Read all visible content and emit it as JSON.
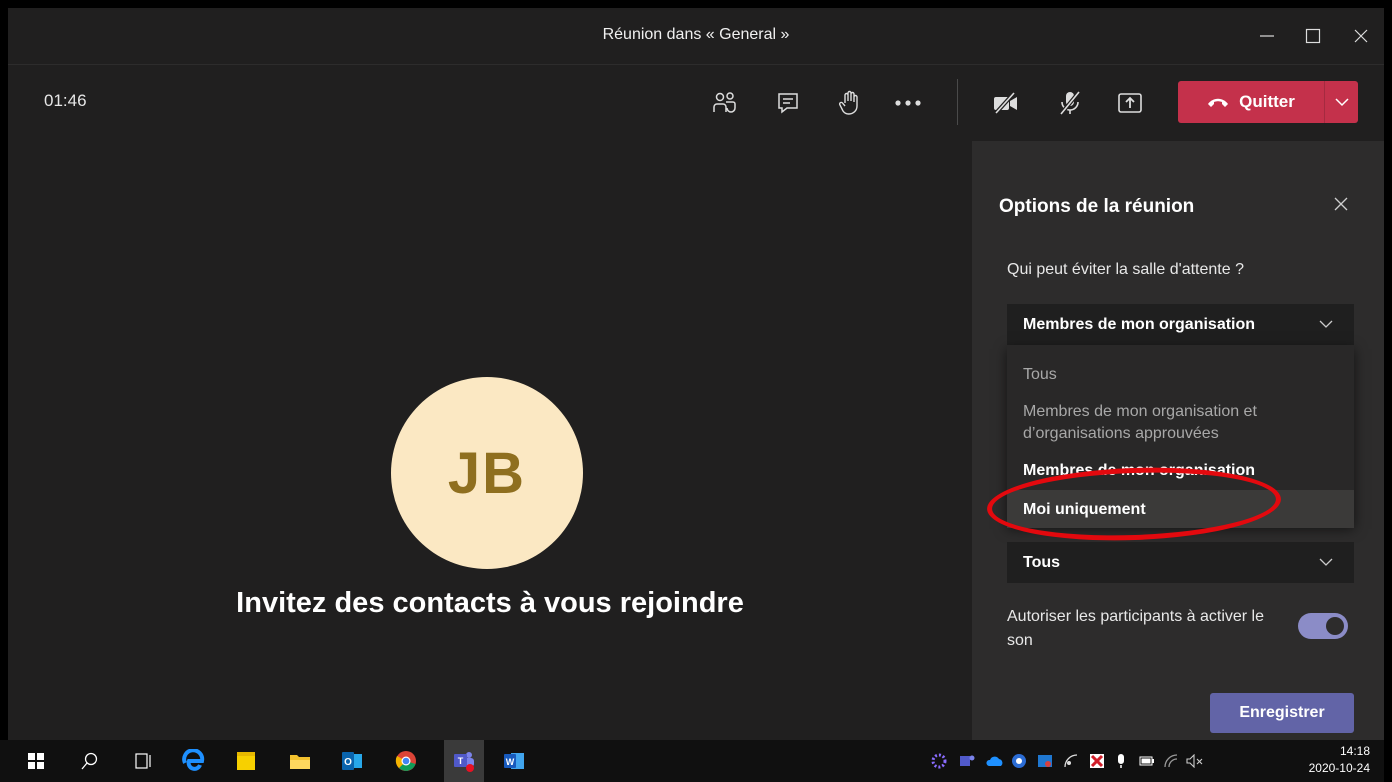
{
  "window": {
    "title": "Réunion dans « General »"
  },
  "toolbar": {
    "timer": "01:46",
    "leave_label": "Quitter",
    "leave_color": "#c4314b"
  },
  "stage": {
    "avatar_initials": "JB",
    "invite_text": "Invitez des contacts à vous rejoindre"
  },
  "panel": {
    "title": "Options de la réunion",
    "lobby_question": "Qui peut éviter la salle d'attente ?",
    "lobby_selected": "Membres de mon organisation",
    "lobby_options": [
      "Tous",
      "Membres de mon organisation et d’organisations approuvées",
      "Membres de mon organisation",
      "Moi uniquement"
    ],
    "presenter_selected": "Tous",
    "allow_unmute_label": "Autoriser les participants à activer le son",
    "save_label": "Enregistrer",
    "accent_color": "#6264a7"
  },
  "taskbar": {
    "time": "14:18",
    "date": "2020-10-24"
  }
}
